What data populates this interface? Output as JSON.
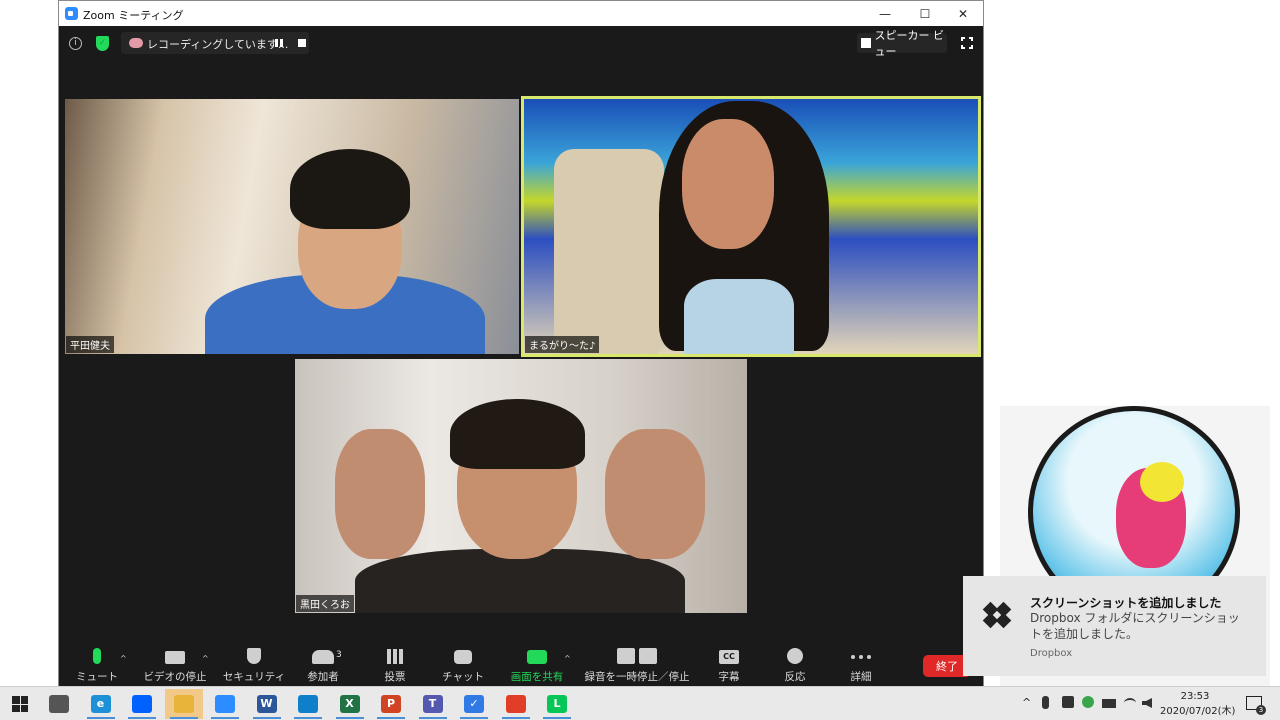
{
  "window": {
    "title": "Zoom ミーティング",
    "minimize": "—",
    "maximize": "☐",
    "close": "✕"
  },
  "topbar": {
    "info_glyph": "i",
    "recording_text": "レコーディングしています...",
    "view_label": "スピーカー ビュー"
  },
  "participants": [
    {
      "name": "平田健夫"
    },
    {
      "name": "まるがり〜た♪",
      "active_speaker": true,
      "highlight_color": "#d8e86a"
    },
    {
      "name": "黒田くろお"
    }
  ],
  "toolbar": {
    "mute": "ミュート",
    "stop_video": "ビデオの停止",
    "security": "セキュリティ",
    "participants": "参加者",
    "participants_count": "3",
    "polls": "投票",
    "chat": "チャット",
    "share_screen": "画面を共有",
    "recording_control": "録音を一時停止／停止",
    "captions": "字幕",
    "captions_glyph": "CC",
    "reactions": "反応",
    "more": "詳細",
    "end": "終了",
    "caret": "^"
  },
  "notification": {
    "title": "スクリーンショットを追加しました",
    "body": "Dropbox フォルダにスクリーンショットを追加しました。",
    "source": "Dropbox"
  },
  "taskbar": {
    "apps": [
      {
        "name": "task-view",
        "glyph": "",
        "color": "#555555"
      },
      {
        "name": "internet-explorer",
        "glyph": "e",
        "color": "#1e90d8"
      },
      {
        "name": "dropbox",
        "glyph": "",
        "color": "#0061fe"
      },
      {
        "name": "file-explorer",
        "glyph": "",
        "color": "#e8b43a",
        "active": true
      },
      {
        "name": "zoom",
        "glyph": "",
        "color": "#2d8cff"
      },
      {
        "name": "word",
        "glyph": "W",
        "color": "#2b579a"
      },
      {
        "name": "edge",
        "glyph": "",
        "color": "#0f7fc9"
      },
      {
        "name": "excel",
        "glyph": "X",
        "color": "#217346"
      },
      {
        "name": "powerpoint",
        "glyph": "P",
        "color": "#d04423"
      },
      {
        "name": "teams",
        "glyph": "T",
        "color": "#5558af"
      },
      {
        "name": "todo",
        "glyph": "✓",
        "color": "#2f7ae5"
      },
      {
        "name": "office",
        "glyph": "",
        "color": "#e23d26"
      },
      {
        "name": "line",
        "glyph": "L",
        "color": "#06c755"
      }
    ],
    "tray_chevron": "^",
    "time": "23:53",
    "date": "2020/07/02(木)",
    "notification_count": "3"
  }
}
